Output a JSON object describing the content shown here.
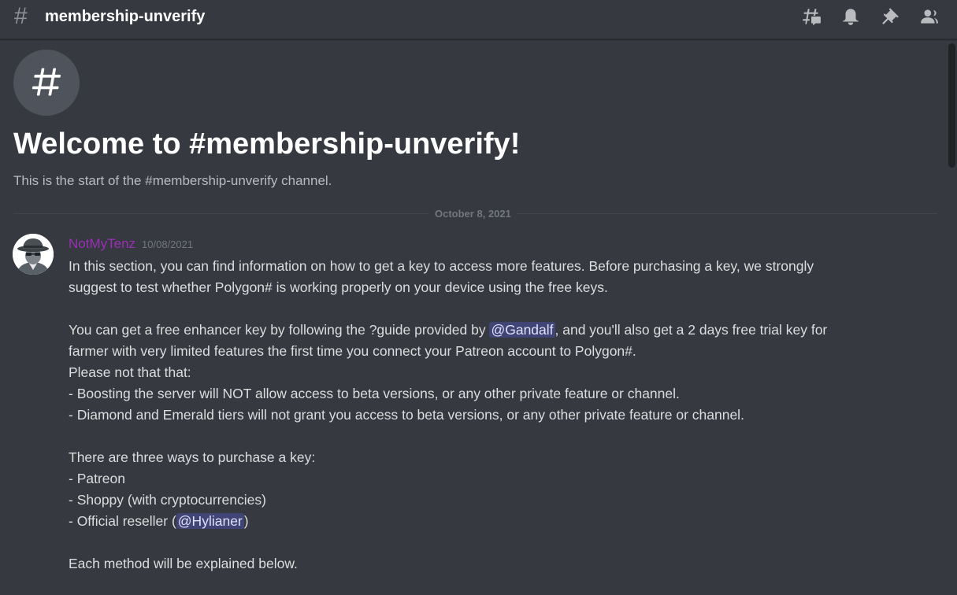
{
  "header": {
    "hash_symbol": "#",
    "channel_name": "membership-unverify",
    "toolbar": [
      "threads-icon",
      "notification-bell-icon",
      "pin-icon",
      "member-list-icon"
    ]
  },
  "welcome": {
    "icon_symbol": "#",
    "title": "Welcome to #membership-unverify!",
    "subtitle": "This is the start of the #membership-unverify channel."
  },
  "divider": {
    "date": "October 8, 2021"
  },
  "message": {
    "author": "NotMyTenz",
    "author_color": "#9b2fb5",
    "timestamp": "10/08/2021",
    "lines": {
      "l1": "In this section, you can find information on how to get a key to access more features. Before purchasing a key, we strongly",
      "l2": "suggest to test whether Polygon# is working properly on your device using the free keys.",
      "l3_pre": "You can get a free enhancer key by following the ?guide provided by ",
      "l3_mention": "@Gandalf",
      "l3_post": ", and you'll also get a 2 days free trial key for",
      "l4": "farmer with very limited features the first time you connect your Patreon account to Polygon#.",
      "l5": "Please not that that:",
      "l6": "- Boosting the server will NOT allow access to beta versions, or any other private feature or channel.",
      "l7": "- Diamond and Emerald tiers will not grant you access to beta versions, or any other private feature or channel.",
      "l8": "There are three ways to purchase a key:",
      "l9": "- Patreon",
      "l10": "- Shoppy (with cryptocurrencies)",
      "l11_pre": "- Official reseller (",
      "l11_mention": "@Hylianer",
      "l11_post": ")",
      "l12": "Each method will be explained below."
    }
  },
  "colors": {
    "background": "#36393f",
    "text": "#dcddde",
    "muted": "#72767d",
    "mention_bg": "rgba(88,101,242,0.3)"
  }
}
